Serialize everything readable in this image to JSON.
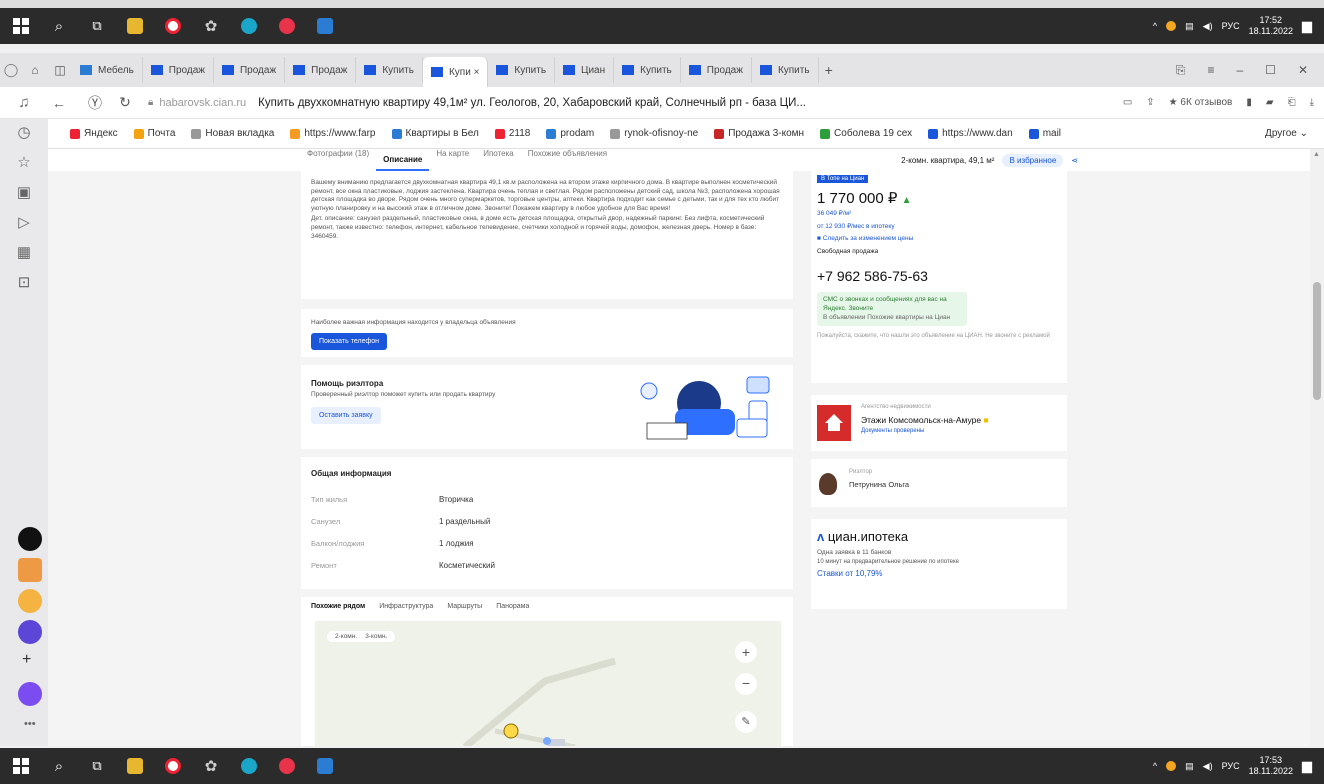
{
  "top_taskbar": {
    "clock_time": "17:52",
    "clock_date": "18.11.2022",
    "lang": "РУС"
  },
  "bottom_taskbar": {
    "clock_time": "17:53",
    "clock_date": "18.11.2022",
    "lang": "РУС"
  },
  "tabs": [
    {
      "label": "Мебель",
      "active": false
    },
    {
      "label": "Продаж",
      "active": false
    },
    {
      "label": "Продаж",
      "active": false
    },
    {
      "label": "Продаж",
      "active": false
    },
    {
      "label": "Купить",
      "active": false
    },
    {
      "label": "Купи ×",
      "active": true
    },
    {
      "label": "Купить",
      "active": false
    },
    {
      "label": "Циан",
      "active": false
    },
    {
      "label": "Купить",
      "active": false
    },
    {
      "label": "Продаж",
      "active": false
    },
    {
      "label": "Купить",
      "active": false
    }
  ],
  "address": {
    "domain": "habarovsk.cian.ru",
    "page_title": "Купить двухкомнатную квартиру 49,1м² ул. Геологов, 20, Хабаровский край, Солнечный рп - база ЦИ...",
    "reviews": "★ 6К отзывов"
  },
  "bookmarks": [
    "Яндекс",
    "Почта",
    "Новая вкладка",
    "https://www.farp",
    "Квартиры в Бел",
    "2118",
    "prodam",
    "rynok-ofisnoy-ne",
    "Продажа 3-комн",
    "Соболева 19 сех",
    "https://www.dan",
    "mail"
  ],
  "bookmarks_other": "Другое",
  "subnav": {
    "items": [
      "Фотографии (18)",
      "Описание",
      "На карте",
      "Ипотека",
      "Похожие объявления"
    ],
    "active_index": 1,
    "summary": "2-комн. квартира, 49,1 м²",
    "fav_label": "В избранное"
  },
  "description": {
    "text": "Вашему вниманию предлагается двухкомнатная квартира 49,1 кв.м расположена на втором этаже кирпичного дома. В квартире выполнен косметический ремонт, все окна пластиковые, лоджия застеклена. Квартира очень теплая и светлая. Рядом расположены детский сад, школа №3, расположена хорошая детская площадка во дворе. Рядом очень много супермаркетов, торговые центры, аптеки. Квартира подходит как семье с детьми, так и для тех кто любит уютную планировку и на высокий этаж в отличном доме. Звоните! Покажем квартиру в любое удобное для Вас время!",
    "text2": "Дет. описание: санузел раздельный, пластиковые окна, в доме есть детская площадка, открытый двор, надежный паркинг. Без лифта, косметический ремонт, также известно: телефон, интернет, кабельное телевидение, счетчики холодной и горячей воды, домофон, железная дверь. Номер в базе: 3460459.",
    "owner_note": "Наиболее важная информация находится у владельца объявления",
    "show_phone": "Показать телефон"
  },
  "realtor_help": {
    "title": "Помощь риэлтора",
    "subtitle": "Проверенный риэлтор поможет купить или продать квартиру",
    "button": "Оставить заявку"
  },
  "general_info": {
    "title": "Общая информация",
    "rows": [
      {
        "label": "Тип жилья",
        "value": "Вторичка"
      },
      {
        "label": "Санузел",
        "value": "1 раздельный"
      },
      {
        "label": "Балкон/лоджия",
        "value": "1 лоджия"
      },
      {
        "label": "Ремонт",
        "value": "Косметический"
      }
    ]
  },
  "map_tabs": [
    "Похожие рядом",
    "Инфраструктура",
    "Маршруты",
    "Панорама"
  ],
  "map_chips": [
    "2-комн.",
    "3-комн."
  ],
  "price": {
    "badge": "В Топе на Циан",
    "value": "1 770 000 ₽",
    "per_m2": "36 049 ₽/м²",
    "mortgage": "от 12 930 ₽/мес в ипотеку",
    "watch": "Следить за изменением цены",
    "sale_type": "Свободная продажа",
    "phone": "+7 962 586-75-63",
    "sms_title": "СМС о звонках и сообщениях для вас на Яндекс. Звоните",
    "sms_sub": "В объявлении Похожие квартиры на Циан",
    "note": "Пожалуйста, скажите, что нашли это объявление на ЦИАН. Не звоните с рекламой"
  },
  "agency": {
    "caption": "Агентство недвижимости",
    "name": "Этажи Комсомольск-на-Амуре",
    "docs": "Документы проверены"
  },
  "agent": {
    "caption": "Риэлтор",
    "name": "Петрунина Ольга"
  },
  "ipoteka": {
    "logo": "циан.ипотека",
    "line1": "Одна заявка в 11 банков",
    "line2": "10 минут на предварительное решение по ипотеке",
    "rate": "Ставки от 10,79%"
  },
  "colors": {
    "accent": "#1a56db",
    "taskbar": "#2b2b2b",
    "agency_logo": "#d62b2b",
    "price_green": "#2e9e3b"
  }
}
